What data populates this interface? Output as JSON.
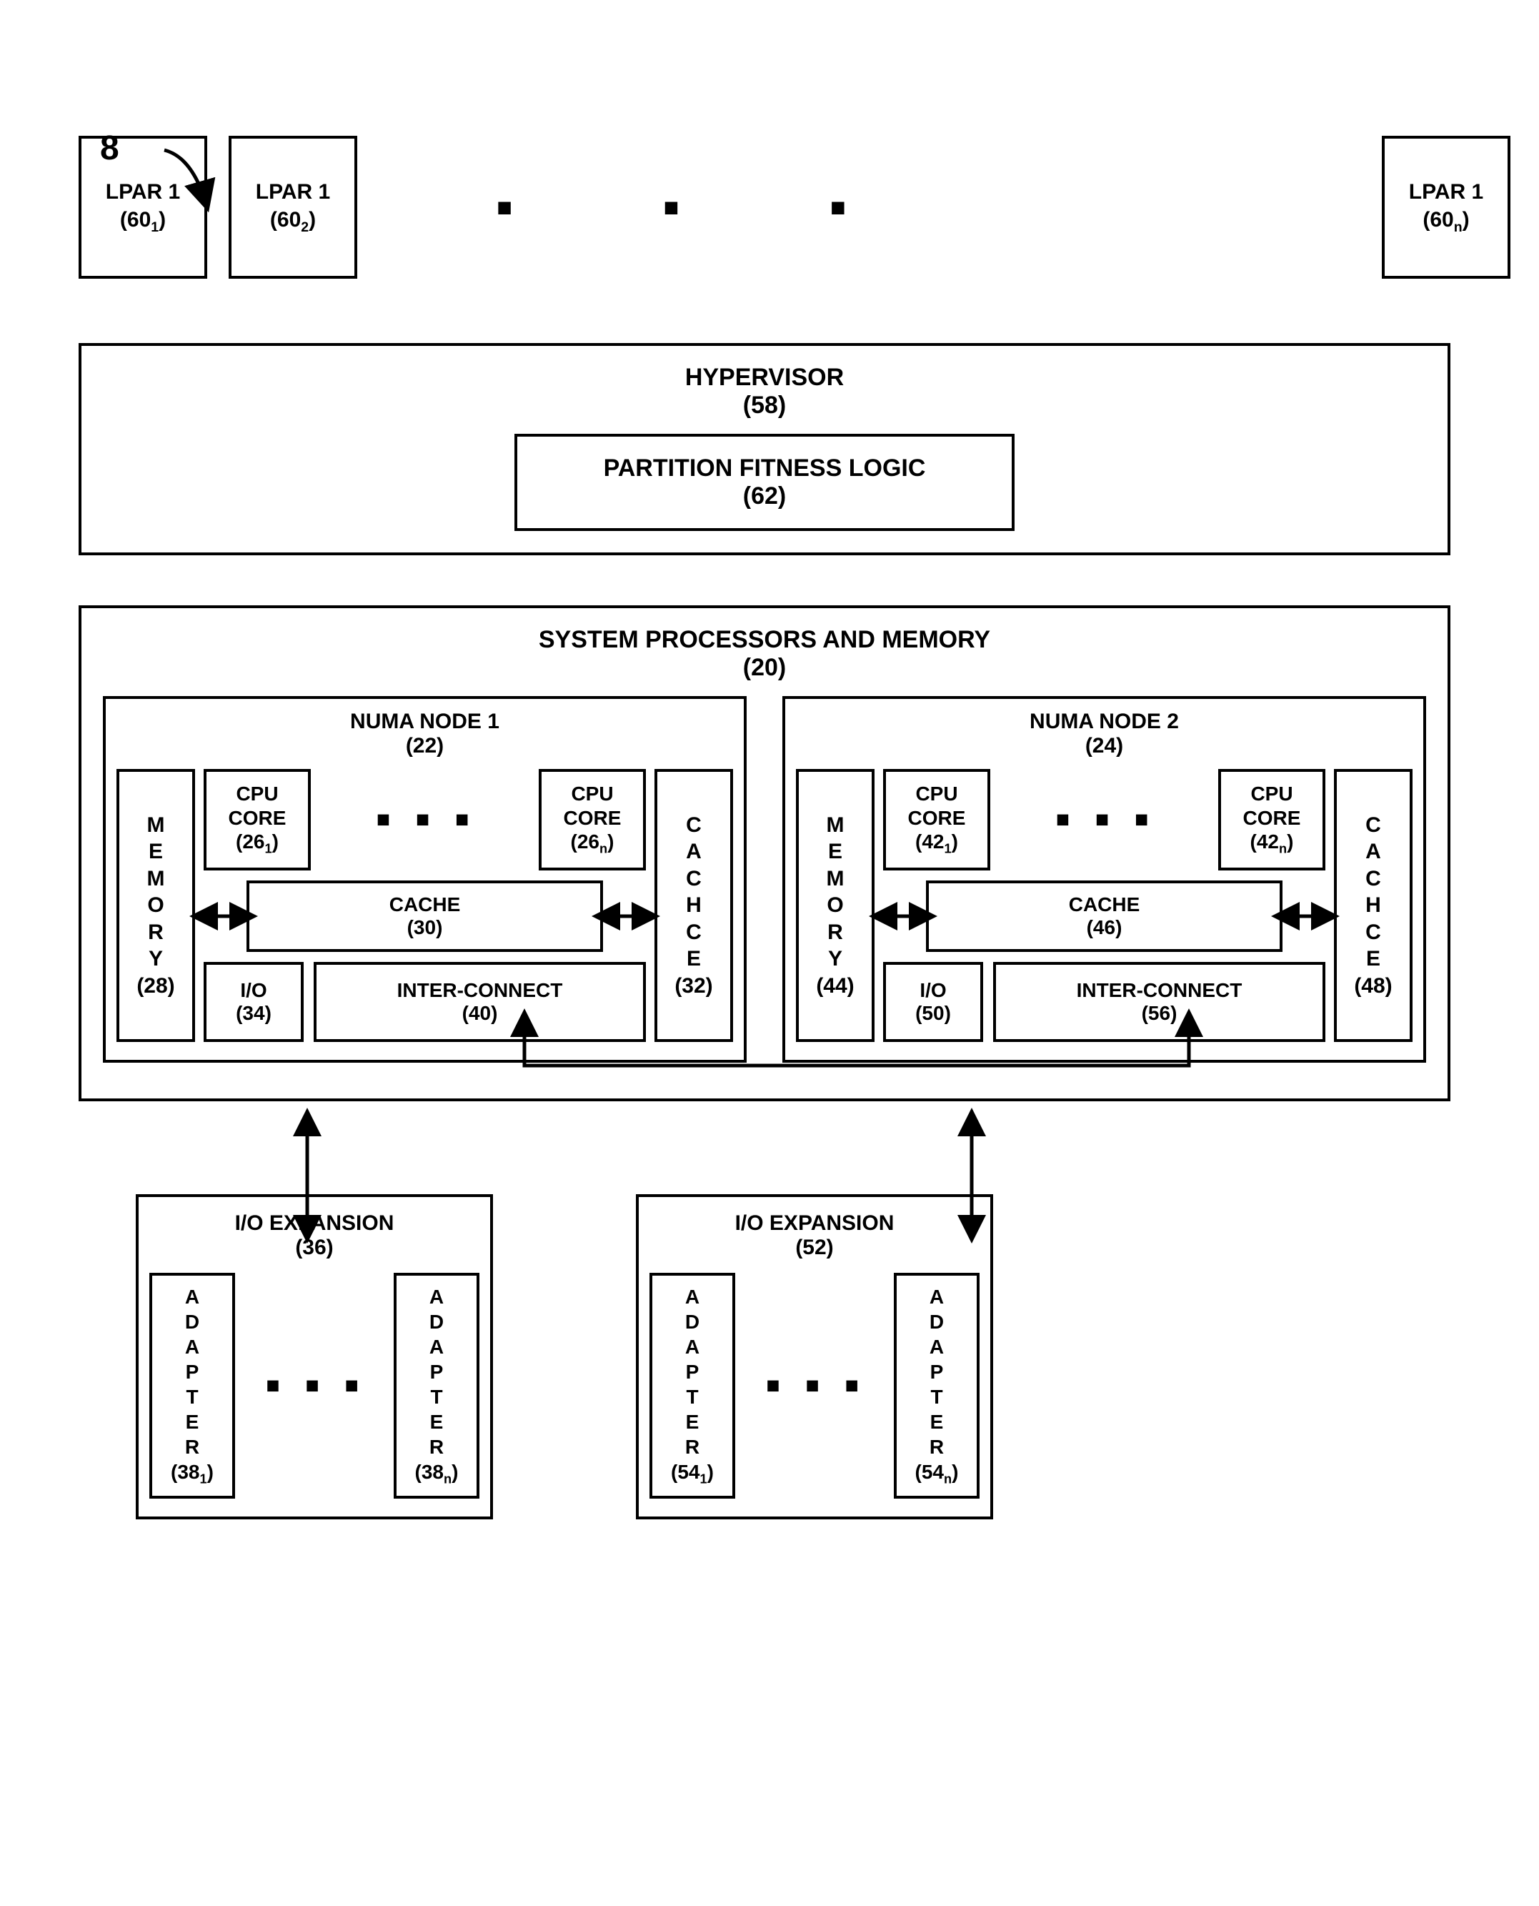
{
  "figure_number": "8",
  "lpars": [
    {
      "label": "LPAR 1",
      "ref": "(60",
      "sub": "1",
      "after": ")"
    },
    {
      "label": "LPAR 1",
      "ref": "(60",
      "sub": "2",
      "after": ")"
    },
    {
      "label": "LPAR 1",
      "ref": "(60",
      "sub": "n",
      "after": ")"
    }
  ],
  "hypervisor": {
    "label": "HYPERVISOR",
    "ref": "(58)"
  },
  "partition_fitness": {
    "label": "PARTITION FITNESS LOGIC",
    "ref": "(62)"
  },
  "system_block": {
    "label": "SYSTEM PROCESSORS AND MEMORY",
    "ref": "(20)"
  },
  "numa1": {
    "label": "NUMA NODE 1",
    "ref": "(22)",
    "memory": {
      "text": "MEMORY",
      "ref": "(28)"
    },
    "cpu1": {
      "label": "CPU CORE",
      "ref": "(26",
      "sub": "1",
      "after": ")"
    },
    "cpu2": {
      "label": "CPU CORE",
      "ref": "(26",
      "sub": "n",
      "after": ")"
    },
    "cache_mid": {
      "label": "CACHE",
      "ref": "(30)"
    },
    "vcache": {
      "text": "CACHCE",
      "ref": "(32)"
    },
    "io": {
      "label": "I/O",
      "ref": "(34)"
    },
    "inter": {
      "label": "INTER-CONNECT",
      "ref": "(40)"
    }
  },
  "numa2": {
    "label": "NUMA NODE 2",
    "ref": "(24)",
    "memory": {
      "text": "MEMORY",
      "ref": "(44)"
    },
    "cpu1": {
      "label": "CPU CORE",
      "ref": "(42",
      "sub": "1",
      "after": ")"
    },
    "cpu2": {
      "label": "CPU CORE",
      "ref": "(42",
      "sub": "n",
      "after": ")"
    },
    "cache_mid": {
      "label": "CACHE",
      "ref": "(46)"
    },
    "vcache": {
      "text": "CACHCE",
      "ref": "(48)"
    },
    "io": {
      "label": "I/O",
      "ref": "(50)"
    },
    "inter": {
      "label": "INTER-CONNECT",
      "ref": "(56)"
    }
  },
  "ioexp1": {
    "label": "I/O EXPANSION",
    "ref": "(36)",
    "a1": {
      "text": "ADAPTER",
      "ref": "(38",
      "sub": "1",
      "after": ")"
    },
    "a2": {
      "text": "ADAPTER",
      "ref": "(38",
      "sub": "n",
      "after": ")"
    }
  },
  "ioexp2": {
    "label": "I/O EXPANSION",
    "ref": "(52)",
    "a1": {
      "text": "ADAPTER",
      "ref": "(54",
      "sub": "1",
      "after": ")"
    },
    "a2": {
      "text": "ADAPTER",
      "ref": "(54",
      "sub": "n",
      "after": ")"
    }
  }
}
